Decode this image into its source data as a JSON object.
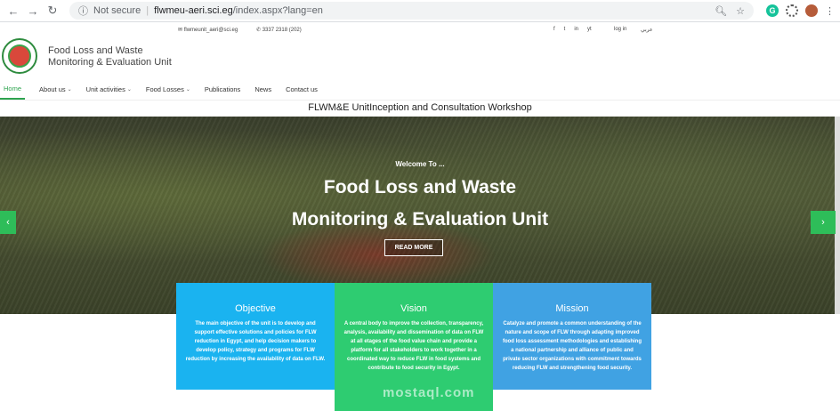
{
  "browser": {
    "security": "Not secure",
    "url_host": "flwmeu-aeri.sci.eg",
    "url_path": "/index.aspx?lang=en"
  },
  "topbar": {
    "email": "flwmeunit_aeri@sci.eg",
    "phone": "3337 2318 (202)",
    "social": [
      "f",
      "t",
      "in",
      "yt"
    ],
    "login": "log in",
    "arabic": "عربي"
  },
  "header": {
    "title_line1": "Food Loss and Waste",
    "title_line2": "Monitoring & Evaluation Unit"
  },
  "nav": {
    "items": [
      {
        "label": "Home"
      },
      {
        "label": "About us"
      },
      {
        "label": "Unit activities"
      },
      {
        "label": "Food Losses"
      },
      {
        "label": "Publications"
      },
      {
        "label": "News"
      },
      {
        "label": "Contact us"
      }
    ]
  },
  "ticker": "FLWM&E UnitInception and Consultation Workshop",
  "hero": {
    "welcome": "Welcome To ...",
    "title_line1": "Food Loss and Waste",
    "title_line2": "Monitoring & Evaluation Unit",
    "button": "READ MORE",
    "prev": "‹",
    "next": "›"
  },
  "cards": {
    "objective": {
      "title": "Objective",
      "text": "The main objective of the unit is to develop and support effective solutions and policies for FLW reduction in Egypt, and help decision makers to develop policy, strategy and programs for FLW reduction by increasing the availability of data on FLW."
    },
    "vision": {
      "title": "Vision",
      "text": "A central body to improve the collection, transparency, analysis, availability and dissemination of data on FLW at all etages of the food value chain and provide a platform for all stakeholders to work together in a coordinated way to reduce FLW in food systems and contribute to food security in Egypt."
    },
    "mission": {
      "title": "Mission",
      "text": "Catalyze and promote a common understanding of the nature and scope of FLW through adapting improved food loss assessment methodologies and establishing a national partnership and alliance of public and private sector organizations with commitment towards reducing FLW and strengthening food security."
    }
  },
  "watermark": "mostaql.com"
}
